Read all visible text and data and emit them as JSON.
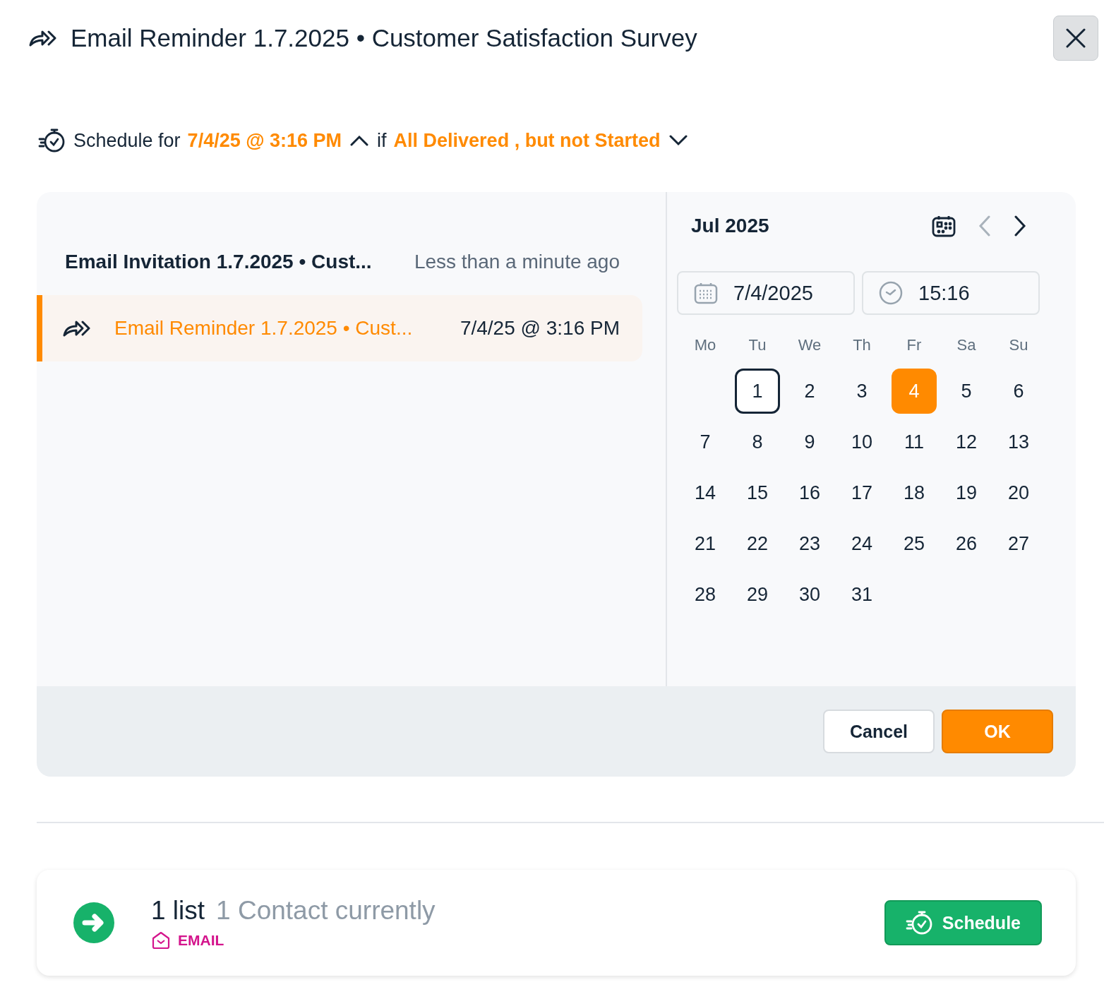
{
  "header": {
    "title": "Email Reminder 1.7.2025 • Customer Satisfaction Survey"
  },
  "schedule_line": {
    "prefix": "Schedule for",
    "when": "7/4/25 @ 3:16 PM",
    "expanded": true,
    "connector": "if",
    "condition": "All Delivered , but not Started",
    "condition_expanded": false
  },
  "history": [
    {
      "kind": "sent",
      "name": "Email Invitation 1.7.2025 • Cust...",
      "time": "Less than a minute ago",
      "selected": false
    },
    {
      "kind": "scheduled",
      "name": "Email Reminder 1.7.2025 • Cust...",
      "time": "7/4/25 @ 3:16 PM",
      "selected": true
    }
  ],
  "calendar": {
    "month": "Jul 2025",
    "date_value": "7/4/2025",
    "time_value": "15:16",
    "prev_disabled": true,
    "weekdays": [
      "Mo",
      "Tu",
      "We",
      "Th",
      "Fr",
      "Sa",
      "Su"
    ],
    "days": [
      {
        "kind": "blank"
      },
      {
        "kind": "day",
        "label": "1",
        "today": true,
        "selected": false
      },
      {
        "kind": "day",
        "label": "2",
        "today": false,
        "selected": false
      },
      {
        "kind": "day",
        "label": "3",
        "today": false,
        "selected": false
      },
      {
        "kind": "day",
        "label": "4",
        "today": false,
        "selected": true
      },
      {
        "kind": "day",
        "label": "5",
        "today": false,
        "selected": false
      },
      {
        "kind": "day",
        "label": "6",
        "today": false,
        "selected": false
      },
      {
        "kind": "day",
        "label": "7",
        "today": false,
        "selected": false
      },
      {
        "kind": "day",
        "label": "8",
        "today": false,
        "selected": false
      },
      {
        "kind": "day",
        "label": "9",
        "today": false,
        "selected": false
      },
      {
        "kind": "day",
        "label": "10",
        "today": false,
        "selected": false
      },
      {
        "kind": "day",
        "label": "11",
        "today": false,
        "selected": false
      },
      {
        "kind": "day",
        "label": "12",
        "today": false,
        "selected": false
      },
      {
        "kind": "day",
        "label": "13",
        "today": false,
        "selected": false
      },
      {
        "kind": "day",
        "label": "14",
        "today": false,
        "selected": false
      },
      {
        "kind": "day",
        "label": "15",
        "today": false,
        "selected": false
      },
      {
        "kind": "day",
        "label": "16",
        "today": false,
        "selected": false
      },
      {
        "kind": "day",
        "label": "17",
        "today": false,
        "selected": false
      },
      {
        "kind": "day",
        "label": "18",
        "today": false,
        "selected": false
      },
      {
        "kind": "day",
        "label": "19",
        "today": false,
        "selected": false
      },
      {
        "kind": "day",
        "label": "20",
        "today": false,
        "selected": false
      },
      {
        "kind": "day",
        "label": "21",
        "today": false,
        "selected": false
      },
      {
        "kind": "day",
        "label": "22",
        "today": false,
        "selected": false
      },
      {
        "kind": "day",
        "label": "23",
        "today": false,
        "selected": false
      },
      {
        "kind": "day",
        "label": "24",
        "today": false,
        "selected": false
      },
      {
        "kind": "day",
        "label": "25",
        "today": false,
        "selected": false
      },
      {
        "kind": "day",
        "label": "26",
        "today": false,
        "selected": false
      },
      {
        "kind": "day",
        "label": "27",
        "today": false,
        "selected": false
      },
      {
        "kind": "day",
        "label": "28",
        "today": false,
        "selected": false
      },
      {
        "kind": "day",
        "label": "29",
        "today": false,
        "selected": false
      },
      {
        "kind": "day",
        "label": "30",
        "today": false,
        "selected": false
      },
      {
        "kind": "day",
        "label": "31",
        "today": false,
        "selected": false
      }
    ]
  },
  "buttons": {
    "cancel": "Cancel",
    "ok": "OK"
  },
  "audience": {
    "lists": "1 list",
    "contacts": "1 Contact currently",
    "channel": "EMAIL",
    "action": "Schedule"
  }
}
